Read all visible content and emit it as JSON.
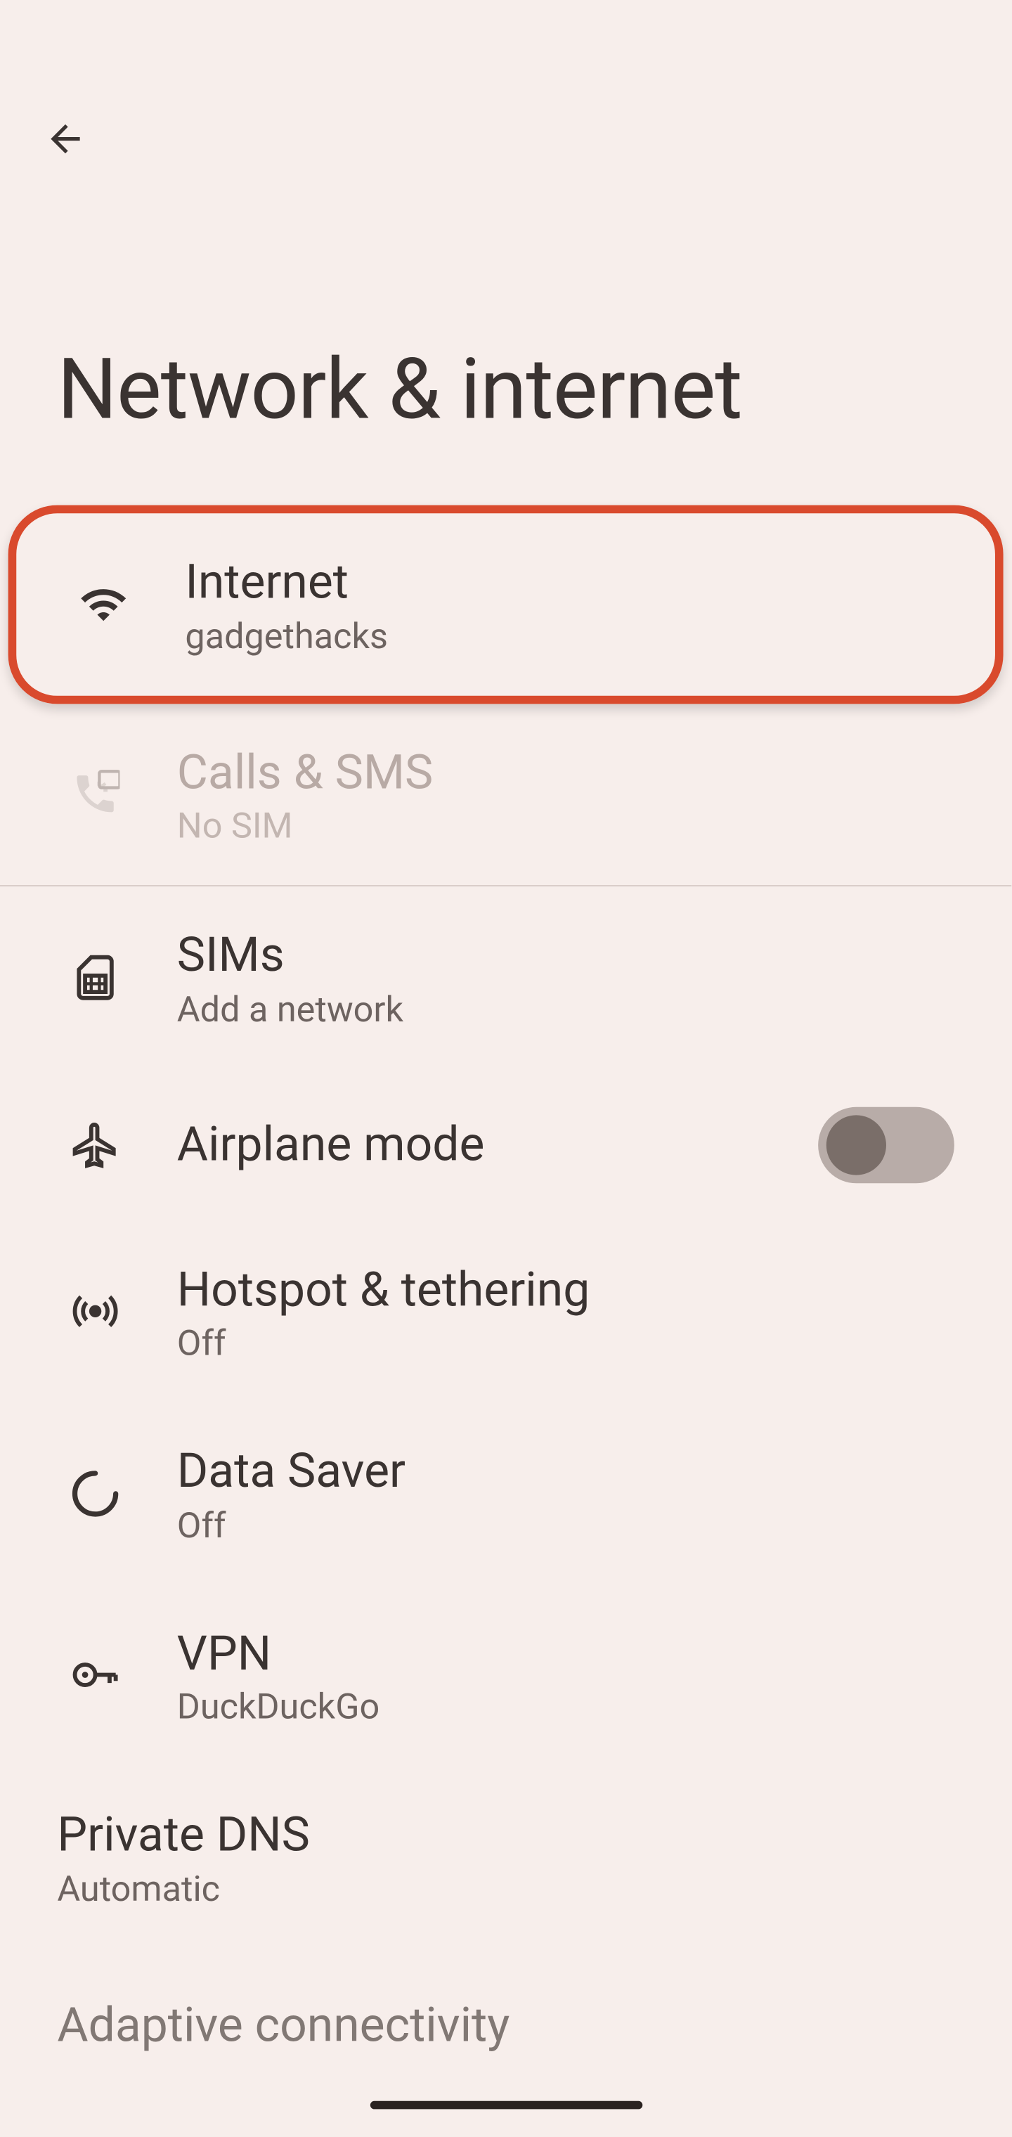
{
  "page_title": "Network & internet",
  "items": [
    {
      "title": "Internet",
      "subtitle": "gadgethacks",
      "icon": "wifi-icon",
      "highlighted": true
    },
    {
      "title": "Calls & SMS",
      "subtitle": "No SIM",
      "icon": "phone-sms-icon",
      "disabled": true
    },
    {
      "title": "SIMs",
      "subtitle": "Add a network",
      "icon": "sim-icon"
    },
    {
      "title": "Airplane mode",
      "icon": "airplane-icon",
      "toggle": true,
      "toggle_on": false
    },
    {
      "title": "Hotspot & tethering",
      "subtitle": "Off",
      "icon": "hotspot-icon"
    },
    {
      "title": "Data Saver",
      "subtitle": "Off",
      "icon": "datasaver-icon"
    },
    {
      "title": "VPN",
      "subtitle": "DuckDuckGo",
      "icon": "vpn-icon"
    },
    {
      "title": "Private DNS",
      "subtitle": "Automatic",
      "no_icon": true
    }
  ],
  "partial_item_title": "Adaptive connectivity"
}
